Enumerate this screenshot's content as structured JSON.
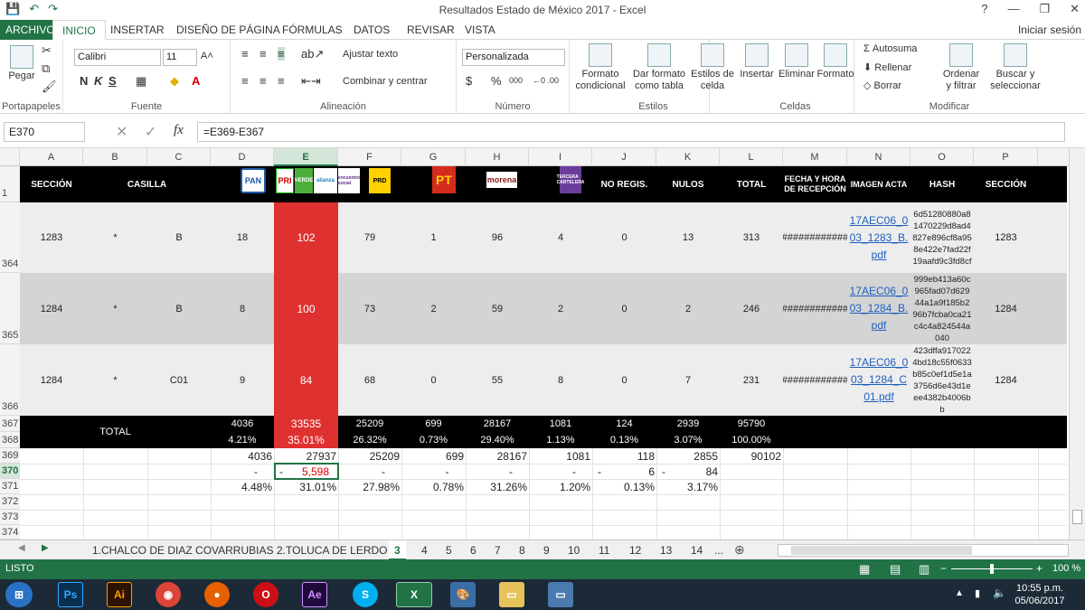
{
  "window": {
    "title": "Resultados Estado de México 2017 - Excel",
    "help": "?",
    "minimize": "—",
    "restore": "❐",
    "close": "✕"
  },
  "qat": {
    "save": "💾",
    "undo": "↶",
    "redo": "↷"
  },
  "tabs": [
    "ARCHIVO",
    "INICIO",
    "INSERTAR",
    "DISEÑO DE PÁGINA",
    "FÓRMULAS",
    "DATOS",
    "REVISAR",
    "VISTA"
  ],
  "signin": "Iniciar sesión",
  "ribbon": {
    "paste": "Pegar",
    "portapapeles": "Portapapeles",
    "font_name": "Calibri",
    "font_size": "11",
    "fuente": "Fuente",
    "bold": "N",
    "italic": "K",
    "underline": "S",
    "ajustar": "Ajustar texto",
    "combinar": "Combinar y centrar",
    "alineacion": "Alineación",
    "number_format": "Personalizada",
    "numero": "Número",
    "dollar": "$",
    "percent": "%",
    "thousands": "000",
    "cond1": "Formato",
    "cond2": "condicional",
    "tabla1": "Dar formato",
    "tabla2": "como tabla",
    "estilos1": "Estilos de",
    "estilos2": "celda",
    "estilos": "Estilos",
    "insertar": "Insertar",
    "eliminar": "Eliminar",
    "formato": "Formato",
    "celdas": "Celdas",
    "autosuma": "Autosuma",
    "rellenar": "Rellenar",
    "borrar": "Borrar",
    "ordenar1": "Ordenar",
    "ordenar2": "y filtrar",
    "buscar1": "Buscar y",
    "buscar2": "seleccionar",
    "modificar": "Modificar"
  },
  "formula_bar": {
    "name_box": "E370",
    "fx": "fx",
    "formula": "=E369-E367"
  },
  "columns": [
    "A",
    "B",
    "C",
    "D",
    "E",
    "F",
    "G",
    "H",
    "I",
    "J",
    "K",
    "L",
    "M",
    "N",
    "O",
    "P"
  ],
  "header_row": {
    "row": "1",
    "seccion": "SECCIÓN",
    "casilla": "CASILLA",
    "pt": "PT",
    "morena": "morena",
    "noreg": "NO REGIS.",
    "nulos": "NULOS",
    "total": "TOTAL",
    "fecha": "FECHA Y HORA DE RECEPCIÓN",
    "imagen": "IMAGEN ACTA",
    "hash": "HASH",
    "seccion2": "SECCIÓN"
  },
  "party_logos": {
    "pan": "PAN",
    "pri": "PRI",
    "verde": "VERDE",
    "alianza": "alianza",
    "encuentro": "encuentro social",
    "prd": "PRD",
    "tercera": "TERCERA CARTELERA"
  },
  "data_rows": [
    {
      "row": "364",
      "a": "1283",
      "b": "*",
      "c": "B",
      "d": "18",
      "e": "102",
      "f": "79",
      "g": "1",
      "h": "96",
      "i": "4",
      "j": "0",
      "k": "13",
      "l": "313",
      "m": "############",
      "n": "17AEC06_003_1283_B.pdf",
      "o": "6d51280880a81470229d8ad4827e896cf8a958e422e7fad22f19aafd9c3fd8cf",
      "p": "1283"
    },
    {
      "row": "365",
      "a": "1284",
      "b": "*",
      "c": "B",
      "d": "8",
      "e": "100",
      "f": "73",
      "g": "2",
      "h": "59",
      "i": "2",
      "j": "0",
      "k": "2",
      "l": "246",
      "m": "############",
      "n": "17AEC06_003_1284_B.pdf",
      "o": "999eb413a60c965fad07d62944a1a9f185b296b7fcba0ca21c4c4a824544a040",
      "p": "1284"
    },
    {
      "row": "366",
      "a": "1284",
      "b": "*",
      "c": "C01",
      "d": "9",
      "e": "84",
      "f": "68",
      "g": "0",
      "h": "55",
      "i": "8",
      "j": "0",
      "k": "7",
      "l": "231",
      "m": "############",
      "n": "17AEC06_003_1284_C01.pdf",
      "o": "423dffa9170224bd18c55f0633b85c0ef1d5e1a3756d6e43d1eee4382b4006bb",
      "p": "1284"
    }
  ],
  "total_rows": {
    "row1": "367",
    "row2": "368",
    "label": "TOTAL",
    "values": [
      "4036",
      "33535",
      "25209",
      "699",
      "28167",
      "1081",
      "124",
      "2939",
      "95790"
    ],
    "percents": [
      "4.21%",
      "35.01%",
      "26.32%",
      "0.73%",
      "29.40%",
      "1.13%",
      "0.13%",
      "3.07%",
      "100.00%"
    ]
  },
  "row369": {
    "row": "369",
    "values": [
      "4036",
      "27937",
      "25209",
      "699",
      "28167",
      "1081",
      "118",
      "2855",
      "90102"
    ]
  },
  "row370": {
    "row": "370",
    "values": [
      "-",
      "5,598",
      "-",
      "-",
      "-",
      "-",
      "6",
      "84"
    ],
    "dash": "-"
  },
  "row371": {
    "row": "371",
    "values": [
      "4.48%",
      "31.01%",
      "27.98%",
      "0.78%",
      "31.26%",
      "1.20%",
      "0.13%",
      "3.17%"
    ]
  },
  "empty_rows": [
    "372",
    "373",
    "374"
  ],
  "sheets": [
    "1.CHALCO DE DIAZ COVARRUBIAS",
    "2.TOLUCA DE LERDO",
    "3",
    "4",
    "5",
    "6",
    "7",
    "8",
    "9",
    "10",
    "11",
    "12",
    "13",
    "14",
    "..."
  ],
  "status": {
    "ready": "LISTO",
    "zoom": "100 %"
  },
  "taskbar": {
    "time": "10:55 p.m.",
    "date": "05/06/2017",
    "apps": [
      "Ps",
      "Ai",
      "Ae",
      "X"
    ]
  },
  "colors": {
    "excel_green": "#217346",
    "header_black": "#000000",
    "highlight_red": "#e03131",
    "row_gray1": "#ededed",
    "row_gray2": "#d4d4d4"
  }
}
